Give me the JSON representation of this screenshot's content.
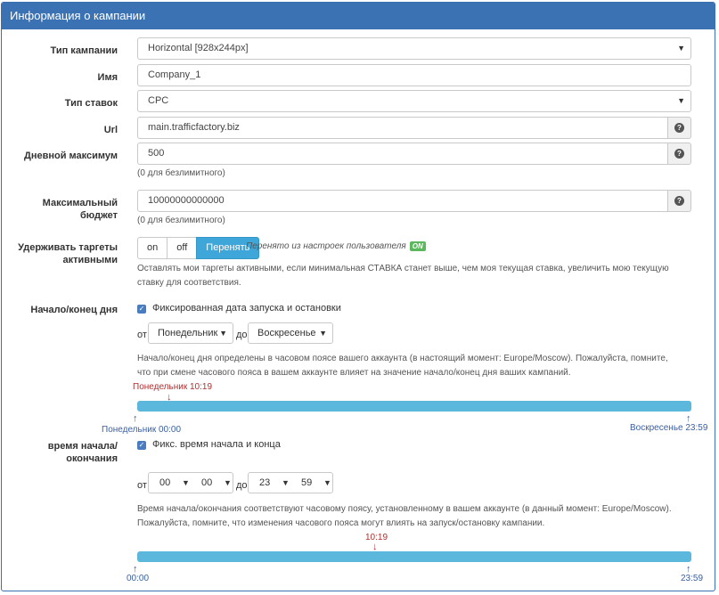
{
  "panel": {
    "title": "Информация о кампании"
  },
  "campaign_type": {
    "label": "Тип кампании",
    "value": "Horizontal [928x244px]"
  },
  "name": {
    "label": "Имя",
    "value": "Company_1"
  },
  "bid_type": {
    "label": "Тип ставок",
    "value": "CPC"
  },
  "url": {
    "label": "Url",
    "value": "main.trafficfactory.biz",
    "help": "?"
  },
  "daily_max": {
    "label": "Дневной максимум",
    "value": "500",
    "help": "?",
    "hint": "(0 для безлимитного)"
  },
  "max_budget": {
    "label_line1": "Максимальный",
    "label_line2": "бюджет",
    "value": "10000000000000",
    "help": "?",
    "hint": "(0 для безлимитного)"
  },
  "keep_targets": {
    "label_line1": "Удерживать таргеты",
    "label_line2": "активными",
    "options": [
      "on",
      "off",
      "Перенять"
    ],
    "selected": "Перенять",
    "inherited_note": "Перенято из настроек пользователя",
    "inherited_badge": "ON",
    "hint": "Оставлять мои таргеты активными, если минимальная СТАВКА станет выше, чем моя текущая ставка, увеличить мою текущую ставку для соответствия."
  },
  "day_range": {
    "label": "Начало/конец дня",
    "checkbox_label": "Фиксированная дата запуска и остановки",
    "from_label": "от",
    "from_value": "Понедельник",
    "to_label": "до",
    "to_value": "Воскресенье",
    "hint": "Начало/конец дня определены в часовом поясе вашего аккаунта (в настоящий момент: Europe/Moscow). Пожалуйста, помните, что при смене часового пояса в вашем аккаунте влияет на значение начало/конец дня ваших кампаний.",
    "marker_label": "Понедельник 10:19",
    "start_label": "Понедельник 00:00",
    "end_label": "Воскресенье 23:59"
  },
  "time_range": {
    "label_line1": "время начала/",
    "label_line2": "окончания",
    "checkbox_label": "Фикс. время начала и конца",
    "from_label": "от",
    "from_hour": "00",
    "from_min": "00",
    "to_label": "до",
    "to_hour": "23",
    "to_min": "59",
    "hint": "Время начала/окончания соответствуют часовому поясу, установленному в вашем аккаунте (в данный момент: Europe/Moscow). Пожалуйста, помните, что изменения часового пояса могут влиять на запуск/остановку кампании.",
    "marker_label": "10:19",
    "start_label": "00:00",
    "end_label": "23:59"
  },
  "icons": {
    "dropdown": "caret-down-icon",
    "help": "question-circle-icon",
    "check": "checkmark-icon",
    "arrow_up": "arrow-up-icon",
    "arrow_down": "arrow-down-icon"
  },
  "colors": {
    "header": "#3b72b4",
    "track": "#5bb8dc",
    "active_button": "#3ea6d8",
    "badge": "#5cb85c",
    "marker": "#b03030"
  }
}
